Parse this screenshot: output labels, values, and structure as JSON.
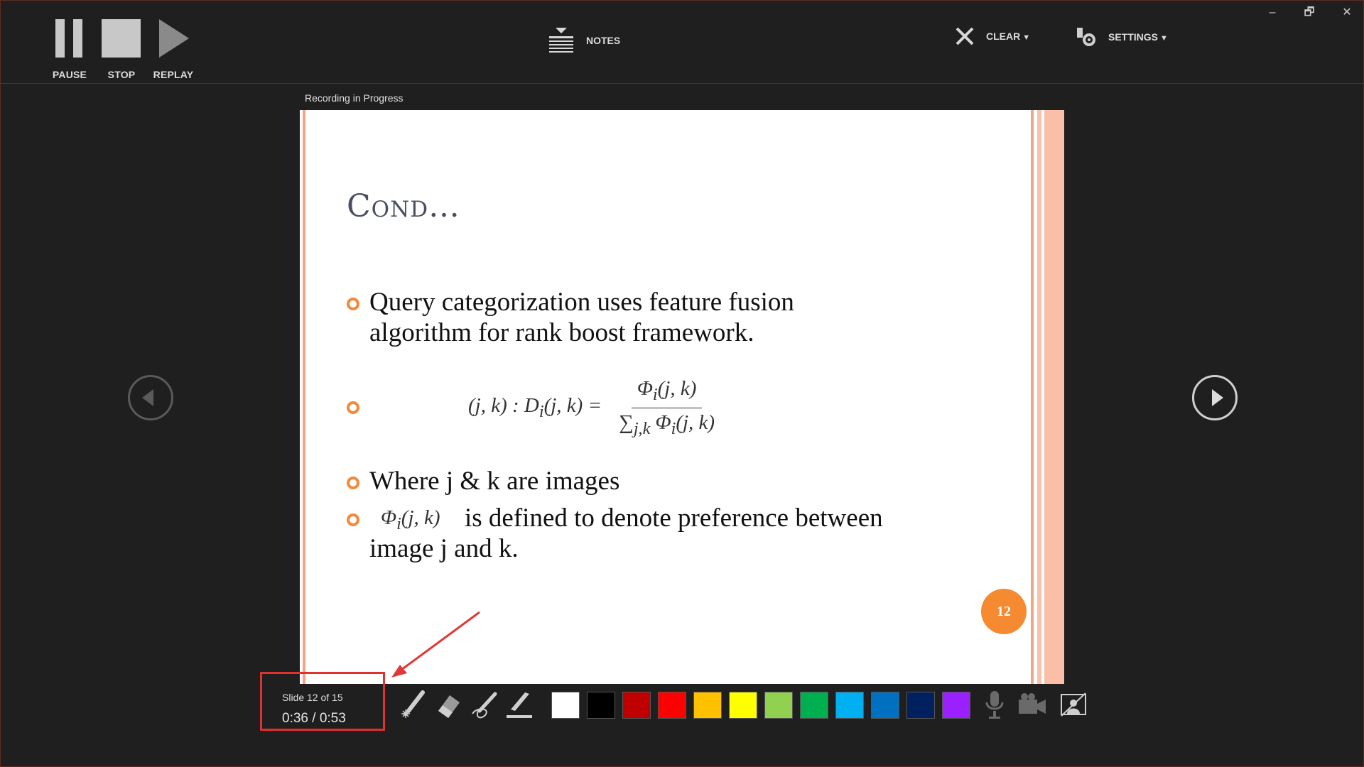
{
  "toolbar": {
    "pause_label": "PAUSE",
    "stop_label": "STOP",
    "replay_label": "REPLAY",
    "notes_label": "NOTES",
    "clear_label": "CLEAR",
    "settings_label": "SETTINGS",
    "caret": "▼"
  },
  "window_controls": {
    "minimize": "–",
    "restore": "🗗",
    "close": "✕"
  },
  "recording_label": "Recording in Progress",
  "slide": {
    "title": "Cond…",
    "bullets": [
      "Query categorization uses feature fusion algorithm for rank boost framework.",
      "Where j & k are images",
      "is defined to denote preference between image j and k."
    ],
    "formula": {
      "lhs": "(j, k) : D",
      "lhs_sub": "i",
      "lhs_rest": "(j, k) =",
      "numerator": "Φ",
      "num_sub": "i",
      "num_rest": "(j, k)",
      "den_sum": "∑",
      "den_sum_sub": "j,k",
      "den_rest": " Φ",
      "den_sub": "i",
      "den_tail": "(j, k)"
    },
    "inline_phi": {
      "symbol": "Φ",
      "sub": "i",
      "rest": "(j, k)"
    },
    "page_number": "12"
  },
  "status": {
    "slide_text": "Slide 12 of 15",
    "time_text": "0:36  /  0:53"
  },
  "colors": [
    "#ffffff",
    "#000000",
    "#c00000",
    "#ff0000",
    "#ffc000",
    "#ffff00",
    "#92d050",
    "#00b050",
    "#00b0f0",
    "#0070c0",
    "#002060",
    "#9a20ff"
  ]
}
